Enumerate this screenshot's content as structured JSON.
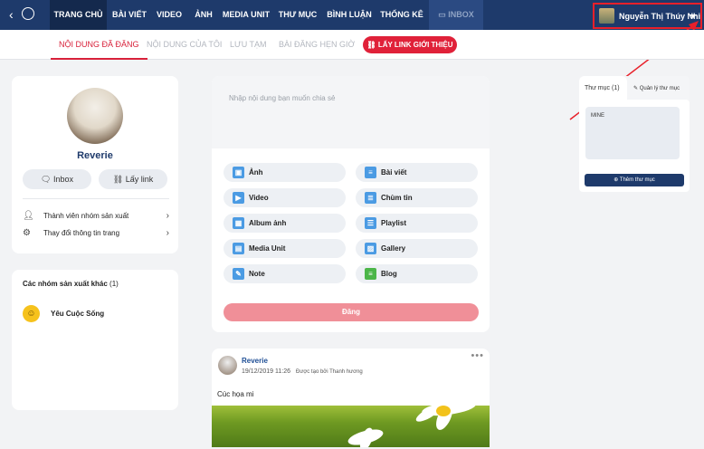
{
  "topnav": {
    "back_icon": "chevron-left-icon",
    "dashboard_icon": "gauge-icon",
    "items": [
      {
        "label": "TRANG CHỦ",
        "active": true
      },
      {
        "label": "BÀI VIẾT"
      },
      {
        "label": "VIDEO"
      },
      {
        "label": "ẢNH"
      },
      {
        "label": "MEDIA UNIT"
      },
      {
        "label": "THƯ MỤC"
      },
      {
        "label": "BÌNH LUẬN"
      },
      {
        "label": "THỐNG KÊ"
      }
    ],
    "inbox_label": "INBOX",
    "user_name": "Nguyễn Thị Thúy Nhi"
  },
  "subnav": {
    "items": [
      {
        "label": "NỘI DUNG ĐÃ ĐĂNG",
        "active": true
      },
      {
        "label": "NỘI DUNG CỦA TÔI"
      },
      {
        "label": "LƯU TẠM"
      },
      {
        "label": "BÀI ĐĂNG HẸN GIỜ"
      }
    ],
    "link_button": "LẤY LINK GIỚI THIỆU"
  },
  "profile": {
    "name": "Reverie",
    "inbox_button": "Inbox",
    "link_button": "Lấy link",
    "menu": [
      {
        "label": "Thành viên nhóm sản xuất",
        "icon": "user-icon"
      },
      {
        "label": "Thay đổi thông tin trang",
        "icon": "gear-icon"
      }
    ]
  },
  "groups": {
    "title": "Các nhóm sản xuất khác",
    "count": "(1)",
    "items": [
      {
        "name": "Yêu Cuộc Sống",
        "icon": "smiley-icon"
      }
    ]
  },
  "composer": {
    "placeholder": "Nhập nội dung bạn muốn chia sẻ",
    "options": [
      {
        "label": "Ảnh",
        "icon": "image-icon"
      },
      {
        "label": "Bài viết",
        "icon": "article-icon"
      },
      {
        "label": "Video",
        "icon": "video-icon"
      },
      {
        "label": "Chùm tin",
        "icon": "news-cluster-icon"
      },
      {
        "label": "Album ảnh",
        "icon": "album-icon"
      },
      {
        "label": "Playlist",
        "icon": "playlist-icon"
      },
      {
        "label": "Media Unit",
        "icon": "media-unit-icon"
      },
      {
        "label": "Gallery",
        "icon": "gallery-icon"
      },
      {
        "label": "Note",
        "icon": "note-icon"
      },
      {
        "label": "Blog",
        "icon": "blog-icon"
      }
    ],
    "post_button": "Đăng"
  },
  "post": {
    "author": "Reverie",
    "date": "19/12/2019 11:26",
    "created_by": "Được tạo bởi Thanh hương",
    "caption": "Cúc họa mi"
  },
  "folders": {
    "title": "Thư mục",
    "count": "(1)",
    "manage_label": "Quản lý thư mục",
    "folder_name": "MINE",
    "add_button": "Thêm thư mục"
  },
  "colors": {
    "nav_bg": "#1e3a6b",
    "accent_red": "#e02139",
    "link_blue": "#1e4e95"
  }
}
